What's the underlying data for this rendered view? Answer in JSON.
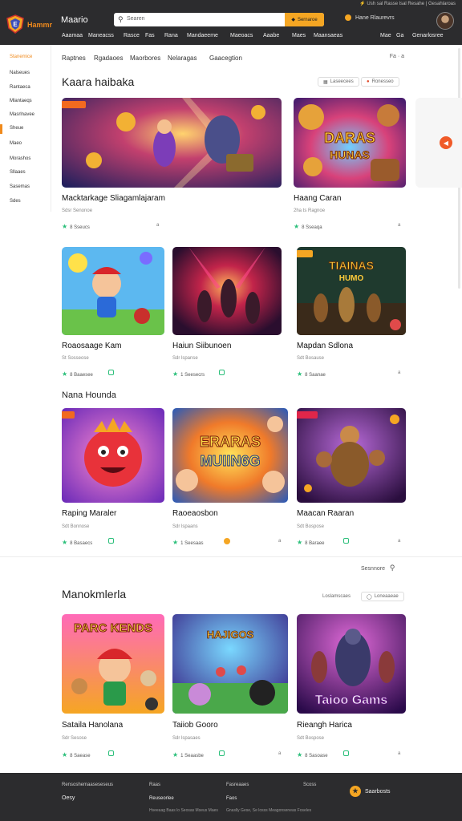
{
  "header": {
    "topline": "⚡ Ush sal Rasse lsal Resahe | Gesahlaroas",
    "brand": "Hammr",
    "site_title": "Maario",
    "search_placeholder": "Searen",
    "search_button": "Sernaroe",
    "account_label": "Hane Rlaurevrs",
    "nav": [
      "Aaamaa",
      "Maneacss",
      "Rasce",
      "Fas",
      "Rana",
      "Mandaeeme",
      "Maeoacs",
      "Aaabe",
      "Maes",
      "Maansaeas",
      "Mae",
      "Ga",
      "Genarlosree"
    ]
  },
  "sidebar": {
    "items": [
      "Stanemice",
      "Nalseues",
      "Rantaeca",
      "Mlantaeqs",
      "Masrlnavee",
      "Sheue",
      "Maeo",
      "Morashos",
      "Sllaaes",
      "Sasemas",
      "Sdes"
    ],
    "active_index": 0
  },
  "tabs": {
    "items": [
      "Raptnes",
      "Rgadaoes",
      "Maorbores",
      "Nelaragas",
      "Gaacegtion"
    ],
    "tools": "Fa · a"
  },
  "section1": {
    "title": "Kaara haibaka",
    "filter1": "Laseecees",
    "filter2": "Ronesseo",
    "cards": [
      {
        "title": "Macktarkage Sliagamlajaram",
        "sub": "Sdsr Senonoe",
        "meta": "8 Sseucs",
        "extra": "a"
      },
      {
        "title": "Haang Caran",
        "sub": "2ha ts Ragnoe",
        "meta": "8 Sseaqa",
        "extra": "a"
      },
      {
        "title": "Roaosaage Kam",
        "sub": "St Sosseose",
        "meta": "8 Baaesee",
        "extra": "a"
      },
      {
        "title": "Haiun Siibunoen",
        "sub": "Sdr lspanse",
        "meta": "1 Seesecrs",
        "extra": "a"
      },
      {
        "title": "Mapdan Sdlona",
        "sub": "Sdt Bosause",
        "meta": "8 Saanae",
        "extra": "a"
      }
    ]
  },
  "section2": {
    "title": "Nana Hounda",
    "cards": [
      {
        "title": "Raping Maraler",
        "sub": "Sdt Bonnose",
        "meta": "8 Basaecs",
        "extra": "a"
      },
      {
        "title": "Raoeaosbon",
        "sub": "Sdr lspaans",
        "meta": "1 Seesaas",
        "extra": "a"
      },
      {
        "title": "Maacan Raaran",
        "sub": "Sdt Bospose",
        "meta": "8 Baraee",
        "extra": "a"
      }
    ],
    "more": "Sesnnore"
  },
  "section3": {
    "title": "Manokmlerla",
    "filter1": "Loslamscaes",
    "filter2": "Loneaaeae",
    "cards": [
      {
        "title": "Sataila Hanolana",
        "sub": "Sdr Sesose",
        "meta": "8 Saease",
        "extra": "a"
      },
      {
        "title": "Taiiob Gooro",
        "sub": "Sdr lspasaes",
        "meta": "1 Seaasbe",
        "extra": "a"
      },
      {
        "title": "Rieangh Harica",
        "sub": "Sdt Bospose",
        "meta": "8 Sasoase",
        "extra": "a"
      }
    ]
  },
  "thumb_text": {
    "card2": [
      "DARAS",
      "HUNAS"
    ],
    "card5": [
      "TIAINAS",
      "HUMO"
    ],
    "s2card2": [
      "ERARAS",
      "MUIIN6G"
    ],
    "s3card1": [
      "PARC KENDS"
    ],
    "s3card2": [
      "HAJIGOS"
    ],
    "s3card3": [
      "Taioo Gams"
    ]
  },
  "footer": {
    "col1": [
      "Rensoshemaaseseseus",
      "Oesy"
    ],
    "col2": [
      "Raas",
      "Reuseorlee",
      "Hseeaag Baas lo Seosas Mseus Maes"
    ],
    "col3": [
      "Fasreaaes",
      "Faos",
      "Gnaslly Gese, Se losss Meagonseneas Foseles"
    ],
    "col4": [
      "Scoss"
    ],
    "brand": "Saarbosts"
  },
  "colors": {
    "accent": "#f08a1c",
    "header_bg": "#2c2c2e",
    "green": "#2bbf7a",
    "tag": "#f26a1f"
  }
}
